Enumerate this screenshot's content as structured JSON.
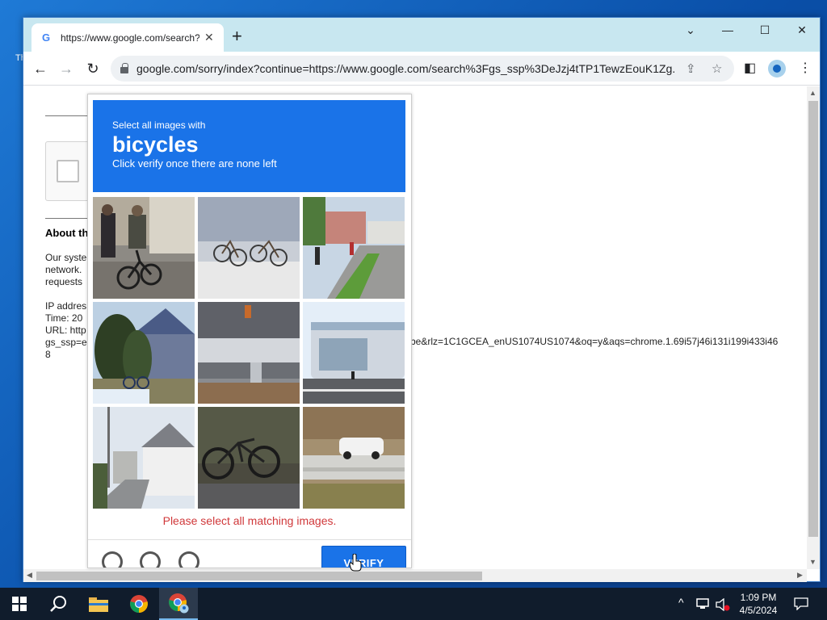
{
  "desktop": {
    "icon_label": "Th"
  },
  "browser": {
    "tab_title": "https://www.google.com/search?",
    "tab_favicon": "G",
    "tab_close": "✕",
    "new_tab": "+",
    "window_controls": {
      "dropdown": "⌄",
      "minimize": "—",
      "maximize": "☐",
      "close": "✕"
    },
    "nav": {
      "back": "←",
      "forward": "→",
      "reload": "↻"
    },
    "url": "google.com/sorry/index?continue=https://www.google.com/search%3Fgs_ssp%3DeJzj4tTP1TewzEouK1Zg...",
    "icons": {
      "share": "⇪",
      "bookmark": "☆",
      "sidebar": "◧",
      "menu": "⋮"
    }
  },
  "page": {
    "about_heading": "About th",
    "para_lines": [
      "Our syste",
      "network.",
      "requests"
    ],
    "ip_line": "IP addres",
    "time_line": "Time: 20",
    "url_line": "URL: http",
    "gs_line": "gs_ssp=e",
    "last_line": "8",
    "url_tail": "be&rlz=1C1GCEA_enUS1074US1074&oq=y&aqs=chrome.1.69i57j46i131i199i433i46"
  },
  "challenge": {
    "line1": "Select all images with",
    "keyword": "bicycles",
    "line3": "Click verify once there are none left",
    "error": "Please select all matching images.",
    "verify_label": "VERIFY",
    "tiles": [
      "tile-person-riding-bicycle",
      "tile-parked-bicycles",
      "tile-street-with-cyclist",
      "tile-house-with-bicycle",
      "tile-station-building",
      "tile-bus-terminal",
      "tile-residential-street",
      "tile-bicycle-closeup",
      "tile-car-on-road"
    ]
  },
  "taskbar": {
    "clock_time": "1:09 PM",
    "clock_date": "4/5/2024",
    "tray_icons": [
      "chevron-up-icon",
      "network-icon",
      "volume-muted-icon"
    ]
  }
}
